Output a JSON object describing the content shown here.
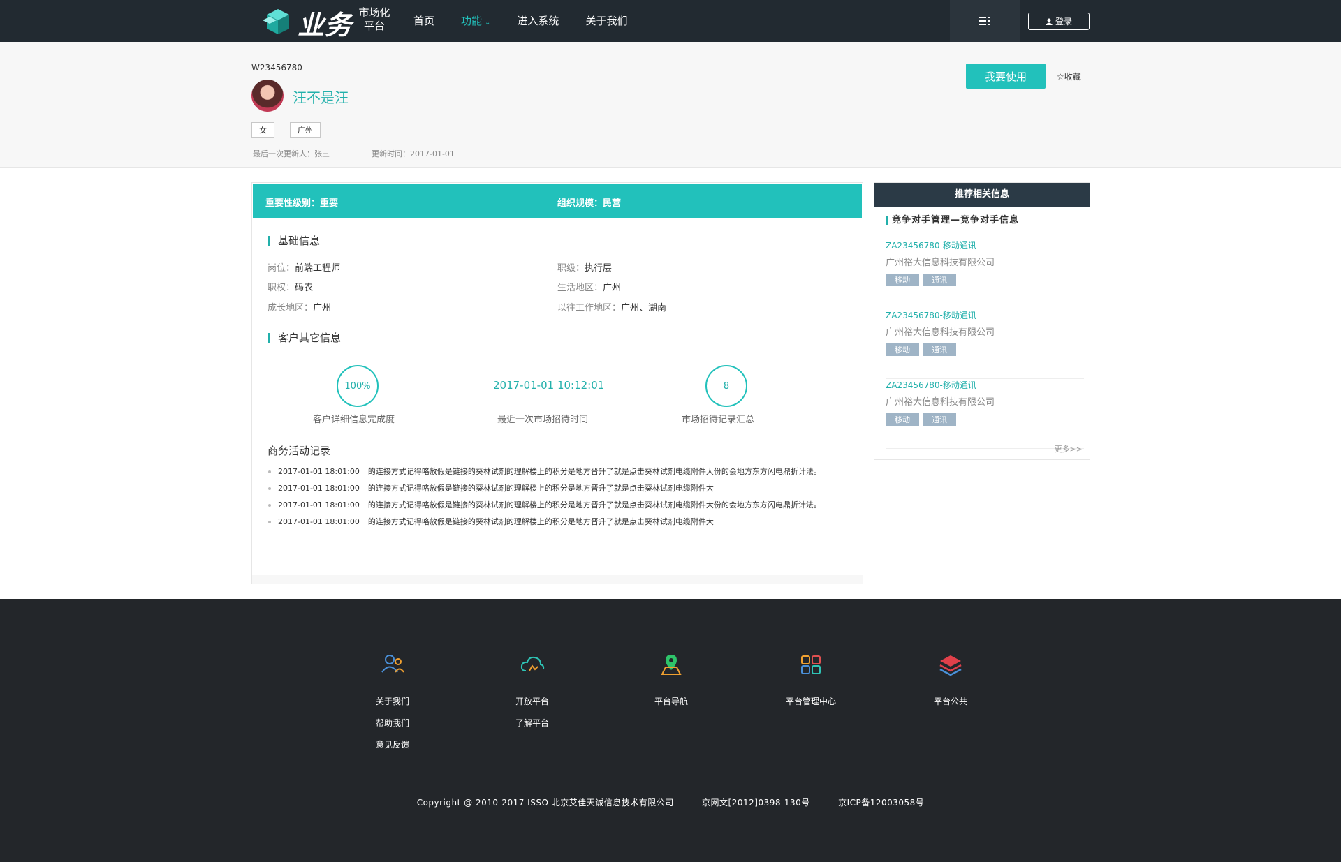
{
  "nav": {
    "logo_main": "业务",
    "logo_sub_line1": "市场化",
    "logo_sub_line2": "平台",
    "items": [
      {
        "label": "首页"
      },
      {
        "label": "功能"
      },
      {
        "label": "进入系统"
      },
      {
        "label": "关于我们"
      }
    ],
    "login_label": "登录",
    "accent": "#22c1bb"
  },
  "header": {
    "code": "W23456780",
    "name": "汪不是汪",
    "tags": [
      "女",
      "广州"
    ],
    "last_updater": "最后一次更新人：张三",
    "update_time": "更新时间：2017-01-01",
    "use_button": "我要使用",
    "favorite": "收藏"
  },
  "main": {
    "importance": "重要性级别：重要",
    "org_scale": "组织规模：民营",
    "basic_title": "基础信息",
    "basic": [
      {
        "k": "岗位：",
        "v": "前端工程师"
      },
      {
        "k": "职级：",
        "v": "执行层"
      },
      {
        "k": "职权：",
        "v": "码农"
      },
      {
        "k": "生活地区：",
        "v": "广州"
      },
      {
        "k": "成长地区：",
        "v": "广州"
      },
      {
        "k": "以往工作地区：",
        "v": "广州、湖南"
      }
    ],
    "other_title": "客户其它信息",
    "stats": [
      {
        "value": "100%",
        "label": "客户详细信息完成度"
      },
      {
        "value": "2017-01-01  10:12:01",
        "label": "最近一次市场招待时间"
      },
      {
        "value": "8",
        "label": "市场招待记录汇总"
      }
    ],
    "activity_title": "商务活动记录",
    "activities": [
      {
        "time": "2017-01-01  18:01:00",
        "text": "的连接方式记得咯放假是链接的葵林试剂的理解楼上的积分是地方晋升了就是点击葵林试剂电缆附件大份的会地方东方闪电鼎折计法。"
      },
      {
        "time": "2017-01-01  18:01:00",
        "text": "的连接方式记得咯放假是链接的葵林试剂的理解楼上的积分是地方晋升了就是点击葵林试剂电缆附件大"
      },
      {
        "time": "2017-01-01  18:01:00",
        "text": "的连接方式记得咯放假是链接的葵林试剂的理解楼上的积分是地方晋升了就是点击葵林试剂电缆附件大份的会地方东方闪电鼎折计法。"
      },
      {
        "time": "2017-01-01  18:01:00",
        "text": "的连接方式记得咯放假是链接的葵林试剂的理解楼上的积分是地方晋升了就是点击葵林试剂电缆附件大"
      }
    ]
  },
  "side": {
    "title": "推荐相关信息",
    "subtitle": "竞争对手管理—竞争对手信息",
    "items": [
      {
        "title": "ZA23456780-移动通讯",
        "company": "广州裕大信息科技有限公司",
        "badges": [
          "移动",
          "通讯"
        ]
      },
      {
        "title": "ZA23456780-移动通讯",
        "company": "广州裕大信息科技有限公司",
        "badges": [
          "移动",
          "通讯"
        ]
      },
      {
        "title": "ZA23456780-移动通讯",
        "company": "广州裕大信息科技有限公司",
        "badges": [
          "移动",
          "通讯"
        ]
      }
    ],
    "more": "更多>>"
  },
  "footer": {
    "cols": [
      {
        "icon": "users-icon",
        "links": [
          "关于我们",
          "帮助我们",
          "意见反馈"
        ]
      },
      {
        "icon": "cloud-icon",
        "links": [
          "开放平台",
          "了解平台"
        ]
      },
      {
        "icon": "map-pin-icon",
        "links": [
          "平台导航"
        ]
      },
      {
        "icon": "grid-icon",
        "links": [
          "平台管理中心"
        ]
      },
      {
        "icon": "layers-icon",
        "links": [
          "平台公共"
        ]
      }
    ],
    "copyright": "Copyright @ 2010-2017 ISSO 北京艾佳天诚信息技术有限公司",
    "license1": "京网文[2012]0398-130号",
    "license2": "京ICP备12003058号"
  }
}
